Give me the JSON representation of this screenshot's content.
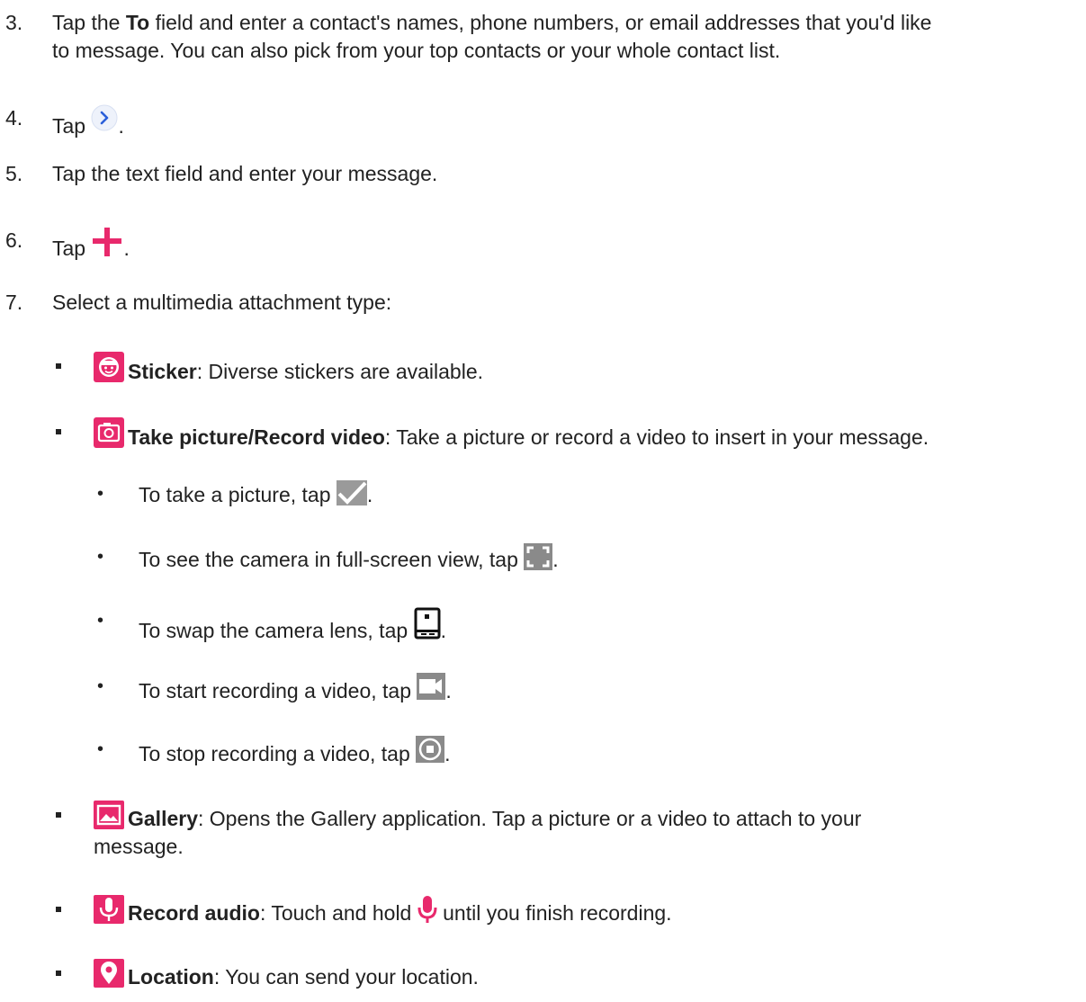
{
  "step3": {
    "num": "3.",
    "pre": "Tap the ",
    "bold": "To",
    "post": " field and enter a contact's names, phone numbers, or email addresses that you'd like",
    "line2": "to message. You can also pick from your top contacts or your whole contact list."
  },
  "step4": {
    "num": "4.",
    "text": "Tap",
    "dot": "."
  },
  "step5": {
    "num": "5.",
    "text": "Tap the text field and enter your message."
  },
  "step6": {
    "num": "6.",
    "text": "Tap",
    "dot": "."
  },
  "step7": {
    "num": "7.",
    "text": "Select a multimedia attachment type:"
  },
  "sticker": {
    "title": "Sticker",
    "desc": ": Diverse stickers are available."
  },
  "camera": {
    "title": "Take picture/Record video",
    "desc": ": Take a picture or record a video to insert in your message."
  },
  "camera_items": [
    {
      "text": "To take a picture, tap",
      "icon": "check-icon"
    },
    {
      "text": "To see the camera in full-screen view, tap",
      "icon": "fullscreen-icon"
    },
    {
      "text": "To swap the camera lens, tap",
      "icon": "swap-camera-icon"
    },
    {
      "text": "To start recording a video, tap",
      "icon": "video-icon"
    },
    {
      "text": "To stop recording a video, tap",
      "icon": "stop-icon"
    }
  ],
  "gallery": {
    "title": "Gallery",
    "desc": ": Opens the Gallery application. Tap a picture or a video to attach to your",
    "line2": "message."
  },
  "audio": {
    "title": "Record audio",
    "desc_pre": ": Touch and hold",
    "desc_post": "until you finish recording."
  },
  "location": {
    "title": "Location",
    "desc": ": You can send your location."
  },
  "colors": {
    "accent": "#e8296c",
    "blue": "#2b5fd9",
    "gray_icon": "#8a8a8a"
  }
}
